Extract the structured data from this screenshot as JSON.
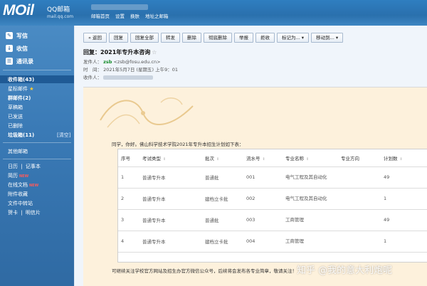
{
  "brand": {
    "logo": "MOil",
    "name": "QQ邮箱",
    "domain": "mail.qq.com"
  },
  "topnav": [
    "邮箱首页",
    "设置",
    "换肤",
    "地址之邮箱"
  ],
  "sidebar": {
    "write": "写信",
    "receive": "收信",
    "contacts": "通讯录",
    "folders": [
      {
        "label": "收件箱(43)",
        "bold": true,
        "active": true
      },
      {
        "label": "星标邮件",
        "star": true
      },
      {
        "label": "群邮件(2)",
        "bold": true
      },
      {
        "label": "草稿箱"
      },
      {
        "label": "已发送"
      },
      {
        "label": "已删除"
      },
      {
        "label": "垃圾箱(11)",
        "bold": true,
        "clear": "[清空]"
      }
    ],
    "other": "其他邮箱",
    "apps": [
      {
        "label": "日历",
        "extra": "记事本"
      },
      {
        "label": "简历",
        "badge": "NEW"
      },
      {
        "label": "在线文档",
        "badge": "NEW"
      },
      {
        "label": "附件收藏"
      },
      {
        "label": "文件中转站"
      },
      {
        "label": "贺卡",
        "extra": "明信片"
      }
    ]
  },
  "toolbar": [
    "« 返回",
    "回复",
    "回复全部",
    "转发",
    "删除",
    "彻底删除",
    "举报",
    "拒收",
    "标记为... ▾",
    "移动到... ▾"
  ],
  "mail": {
    "subject": "回复：2021年专升本咨询",
    "star": "☆",
    "from_label": "发件人：",
    "from_name": "zsb",
    "from_addr": "<zsb@fosu.edu.cn>",
    "time_label": "时　间：",
    "time_value": "2021年5月7日 (星期五) 上午9：01",
    "to_label": "收件人："
  },
  "body": {
    "intro": "同学，你好。佛山科学技术学院2021年专升本招生计划如下表：",
    "footnote": "可继续关注学校官方网站及招生办官方微信公众号，后续将会发布各专业简章，敬请关注！",
    "watermark": "知乎 @我的意大利炮呢"
  },
  "table": {
    "headers": [
      "序号",
      "考试类型",
      "批次",
      "流水号",
      "专业名称",
      "专业方向",
      "计划数"
    ],
    "rows": [
      [
        "1",
        "普通专升本",
        "普通批",
        "001",
        "电气工程及其自动化",
        "",
        "49"
      ],
      [
        "2",
        "普通专升本",
        "建档立卡批",
        "002",
        "电气工程及其自动化",
        "",
        "1"
      ],
      [
        "3",
        "普通专升本",
        "普通批",
        "003",
        "工商管理",
        "",
        "49"
      ],
      [
        "4",
        "普通专升本",
        "建档立卡批",
        "004",
        "工商管理",
        "",
        "1"
      ]
    ]
  },
  "colors": {
    "header": "#2f7ec0",
    "sidebar": "#3a7ab6",
    "body_bg": "#fdf1dc",
    "sender_green": "#118a26"
  }
}
